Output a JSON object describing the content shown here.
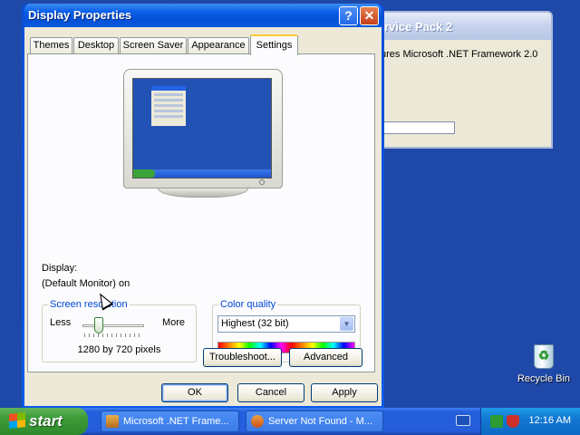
{
  "background_window": {
    "title": "rvice Pack 2",
    "text": "ures Microsoft .NET Framework 2.0"
  },
  "desktop_icons": [
    {
      "label": "Recycle Bin",
      "icon": "recycle-bin-icon"
    }
  ],
  "dialog": {
    "title": "Display Properties",
    "help_glyph": "?",
    "close_glyph": "✕",
    "tabs": [
      {
        "label": "Themes",
        "active": false
      },
      {
        "label": "Desktop",
        "active": false
      },
      {
        "label": "Screen Saver",
        "active": false
      },
      {
        "label": "Appearance",
        "active": false
      },
      {
        "label": "Settings",
        "active": true
      }
    ],
    "display_label": "Display:",
    "display_value": "(Default Monitor) on",
    "resolution": {
      "legend": "Screen resolution",
      "less_label": "Less",
      "more_label": "More",
      "value_text": "1280 by 720 pixels",
      "slider_position": 0.25
    },
    "color_quality": {
      "legend": "Color quality",
      "selected": "Highest (32 bit)"
    },
    "troubleshoot_button": "Troubleshoot...",
    "advanced_button": "Advanced",
    "ok_button": "OK",
    "cancel_button": "Cancel",
    "apply_button": "Apply"
  },
  "taskbar": {
    "start_label": "start",
    "items": [
      {
        "label": "Microsoft .NET Frame...",
        "icon": "installer-icon"
      },
      {
        "label": "Server Not Found - M...",
        "icon": "browser-icon"
      }
    ],
    "clock": "12:16 AM",
    "colors": {
      "taskbar": "#245edb",
      "start": "#3c9a37",
      "tray": "#1278d2"
    }
  }
}
